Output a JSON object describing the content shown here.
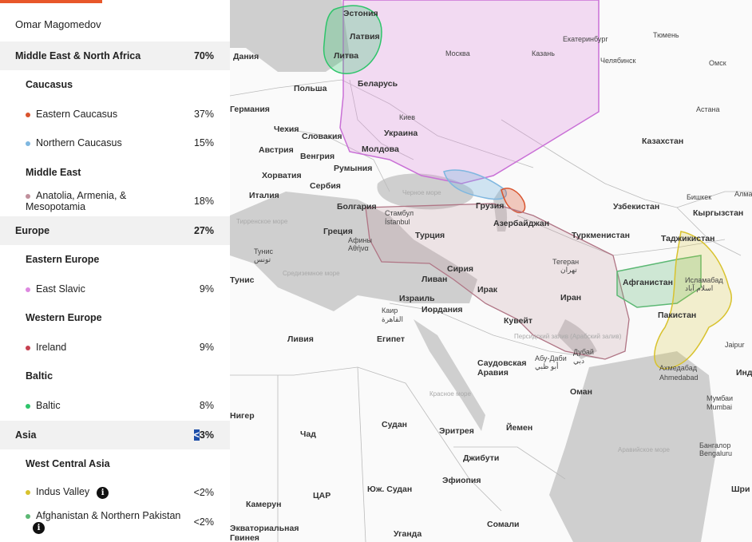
{
  "user_name": "Omar Magomedov",
  "rows": [
    {
      "kind": "region",
      "label": "Middle East & North Africa",
      "pct": "70%"
    },
    {
      "kind": "sub",
      "label": "Caucasus",
      "pct": ""
    },
    {
      "kind": "item",
      "label": "Eastern Caucasus",
      "pct": "37%",
      "color": "#d9542e",
      "info": false
    },
    {
      "kind": "item",
      "label": "Northern Caucasus",
      "pct": "15%",
      "color": "#7fb7e0",
      "info": false
    },
    {
      "kind": "sub",
      "label": "Middle East",
      "pct": ""
    },
    {
      "kind": "item",
      "label": "Anatolia, Armenia, & Mesopotamia",
      "pct": "18%",
      "color": "#c0909c",
      "info": false
    },
    {
      "kind": "region",
      "label": "Europe",
      "pct": "27%"
    },
    {
      "kind": "sub",
      "label": "Eastern Europe",
      "pct": ""
    },
    {
      "kind": "item",
      "label": "East Slavic",
      "pct": "9%",
      "color": "#dd88e0",
      "info": false
    },
    {
      "kind": "sub",
      "label": "Western Europe",
      "pct": ""
    },
    {
      "kind": "item",
      "label": "Ireland",
      "pct": "9%",
      "color": "#c64050",
      "info": false
    },
    {
      "kind": "sub",
      "label": "Baltic",
      "pct": ""
    },
    {
      "kind": "item",
      "label": "Baltic",
      "pct": "8%",
      "color": "#2ec46a",
      "info": false
    },
    {
      "kind": "region",
      "label": "Asia",
      "pct": "<3%"
    },
    {
      "kind": "sub",
      "label": "West Central Asia",
      "pct": ""
    },
    {
      "kind": "item",
      "label": "Indus Valley",
      "pct": "<2%",
      "color": "#d8c22e",
      "info": true
    },
    {
      "kind": "item",
      "label": "Afghanistan & Northern Pakistan",
      "pct": "<2%",
      "color": "#5cb874",
      "info": true
    }
  ],
  "info_glyph": "i",
  "map_labels": {
    "countries": [
      "Эстония",
      "Латвия",
      "Литва",
      "Дания",
      "Польша",
      "Беларусь",
      "Германия",
      "Украина",
      "Чехия",
      "Словакия",
      "Австрия",
      "Венгрия",
      "Молдова",
      "Казахстан",
      "Хорватия",
      "Румыния",
      "Сербия",
      "Италия",
      "Болгария",
      "Узбекистан",
      "Кыргызстан",
      "Грузия",
      "Азербайджан",
      "Туркменистан",
      "Таджикистан",
      "Турция",
      "Греция",
      "Тунис",
      "Сирия",
      "Ливан",
      "Ирак",
      "Иран",
      "Афганистан",
      "Израиль",
      "Иордания",
      "Пакистан",
      "Кувейт",
      "Ливия",
      "Египет",
      "Саудовская",
      "Аравия",
      "Оман",
      "Инд",
      "Нигер",
      "Судан",
      "Чад",
      "Эритрея",
      "Йемен",
      "Джибути",
      "Эфиопия",
      "Юж. Судан",
      "ЦАР",
      "Камерун",
      "Уганда",
      "Сомали",
      "Экваториальная",
      "Гвинея",
      "Шри"
    ],
    "cities": [
      "Екатеринбург",
      "Тюмень",
      "Москва",
      "Казань",
      "Челябинск",
      "Омск",
      "Астана",
      "Киев",
      "Бишкек",
      "Алма",
      "Стамбул",
      "İstanbul",
      "Тегеран",
      "تهران",
      "Афины",
      "Αθήνα",
      "Исламабад",
      "اسلام آباد",
      "Каир",
      "القاهرة",
      "Абу-Даби",
      "أبو ظبي",
      "Дубай",
      "دبي",
      "Ахмедабад",
      "Ahmedabad",
      "Мумбаи",
      "Mumbai",
      "Jaipur",
      "Бангалор",
      "Bengaluru",
      "Туниc",
      "تونس"
    ],
    "seas": [
      "Черное море",
      "Тирренское море",
      "Средиземное море",
      "Персидский залив (Арабский залив)",
      "Красное море",
      "Аравийское море"
    ]
  },
  "colors": {
    "accent": "#e8572a",
    "region_bg": "#f1f1f1"
  }
}
